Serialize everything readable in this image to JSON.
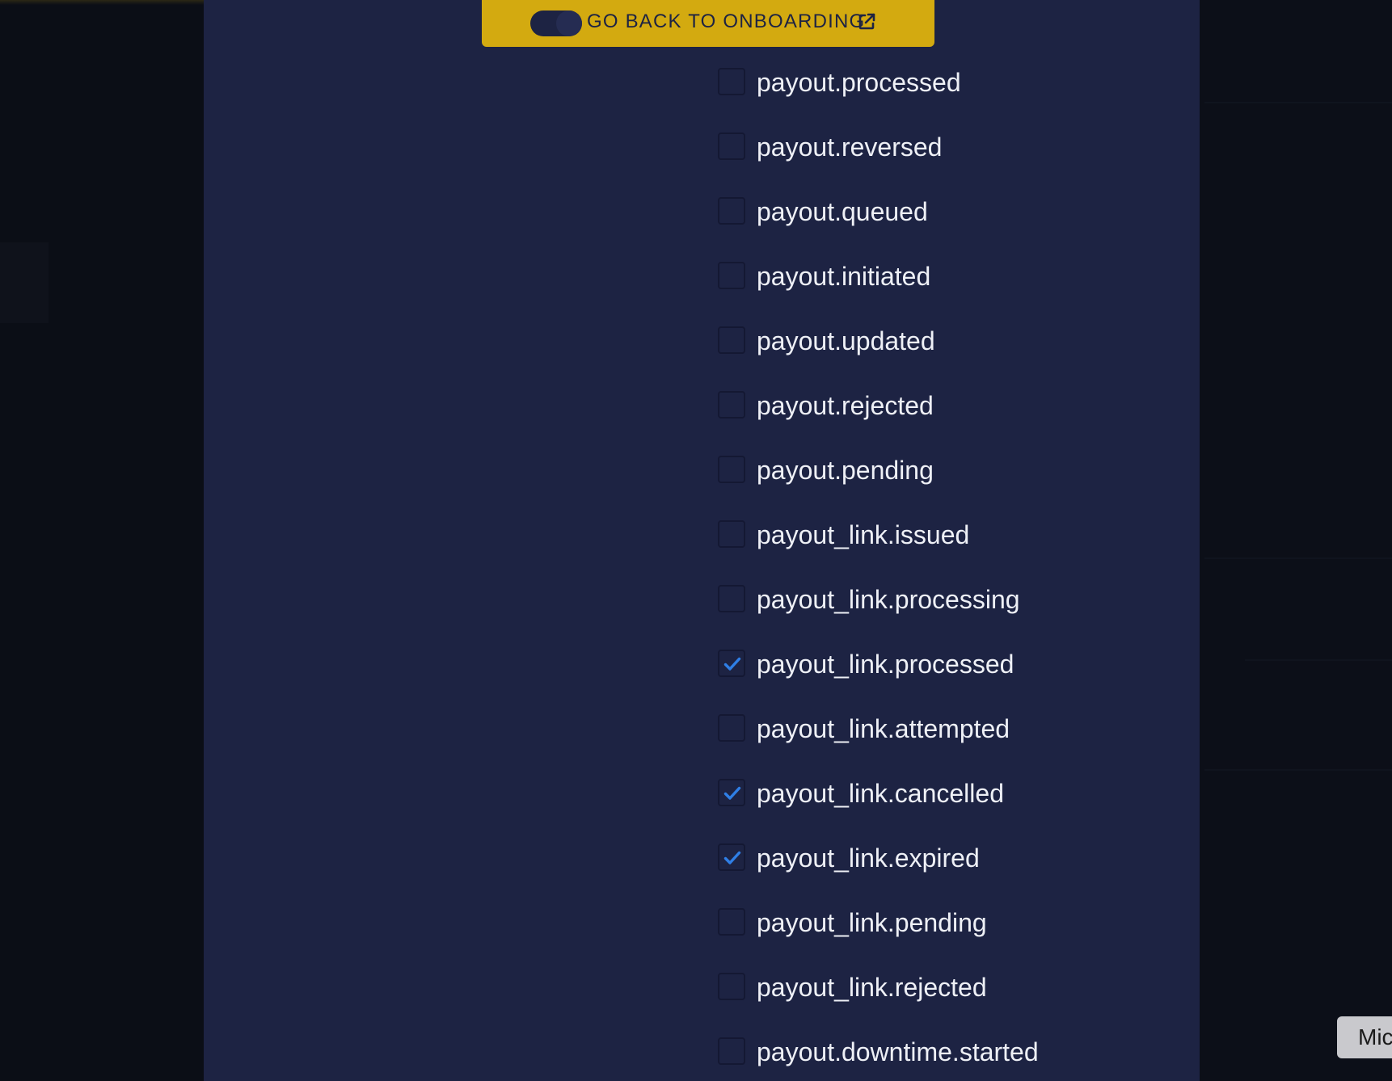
{
  "header": {
    "onboarding_button_label": "GO BACK TO ONBOARDING"
  },
  "colors": {
    "modal_background": "#1d2343",
    "onboarding_button": "#d3aa10",
    "checkmark": "#2f7fe6",
    "label_text": "#eef0f6"
  },
  "icons": {
    "onboarding_external": "external-link-icon",
    "toggle": "toggle-icon",
    "checked": "checkmark-icon"
  },
  "events": [
    {
      "label": "payout.processed",
      "checked": false
    },
    {
      "label": "payout.reversed",
      "checked": false
    },
    {
      "label": "payout.queued",
      "checked": false
    },
    {
      "label": "payout.initiated",
      "checked": false
    },
    {
      "label": "payout.updated",
      "checked": false
    },
    {
      "label": "payout.rejected",
      "checked": false
    },
    {
      "label": "payout.pending",
      "checked": false
    },
    {
      "label": "payout_link.issued",
      "checked": false
    },
    {
      "label": "payout_link.processing",
      "checked": false
    },
    {
      "label": "payout_link.processed",
      "checked": true
    },
    {
      "label": "payout_link.attempted",
      "checked": false
    },
    {
      "label": "payout_link.cancelled",
      "checked": true
    },
    {
      "label": "payout_link.expired",
      "checked": true
    },
    {
      "label": "payout_link.pending",
      "checked": false
    },
    {
      "label": "payout_link.rejected",
      "checked": false
    },
    {
      "label": "payout.downtime.started",
      "checked": false
    }
  ],
  "corner_chip": {
    "label": "Mic"
  }
}
